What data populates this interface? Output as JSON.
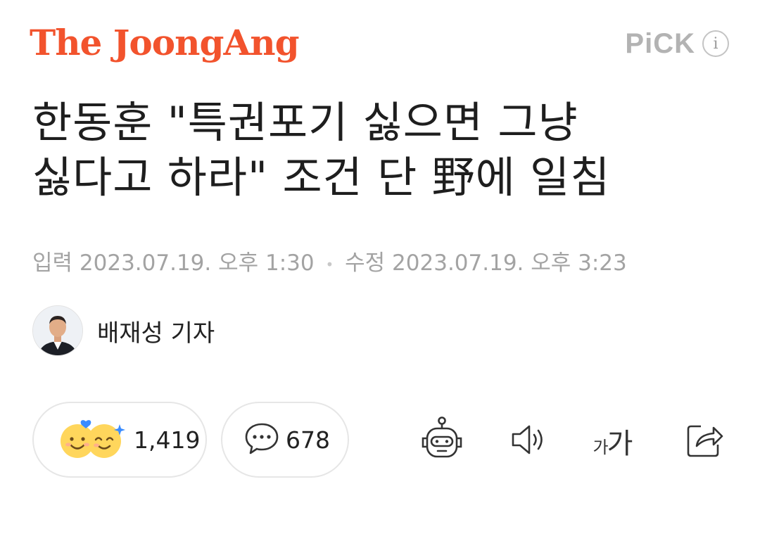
{
  "header": {
    "logo_text": "The JoongAng",
    "pick_label": "PiCK",
    "info_icon": "info-icon",
    "brand_color": "#f2532d"
  },
  "article": {
    "title_line1": "한동훈 \"특권포기 싫으면 그냥",
    "title_line2": "싫다고 하라\" 조건 단 野에 일침",
    "published_label": "입력",
    "published_date": "2023.07.19. 오후 1:30",
    "separator": "•",
    "modified_label": "수정",
    "modified_date": "2023.07.19. 오후 3:23"
  },
  "author": {
    "name": "배재성 기자"
  },
  "actions": {
    "reaction_count": "1,419",
    "comment_count": "678",
    "font_size_label_small": "가",
    "font_size_label_large": "가",
    "icons": [
      "reaction-icon",
      "comment-icon",
      "robot-summary-icon",
      "speaker-icon",
      "font-size-icon",
      "share-icon"
    ]
  }
}
